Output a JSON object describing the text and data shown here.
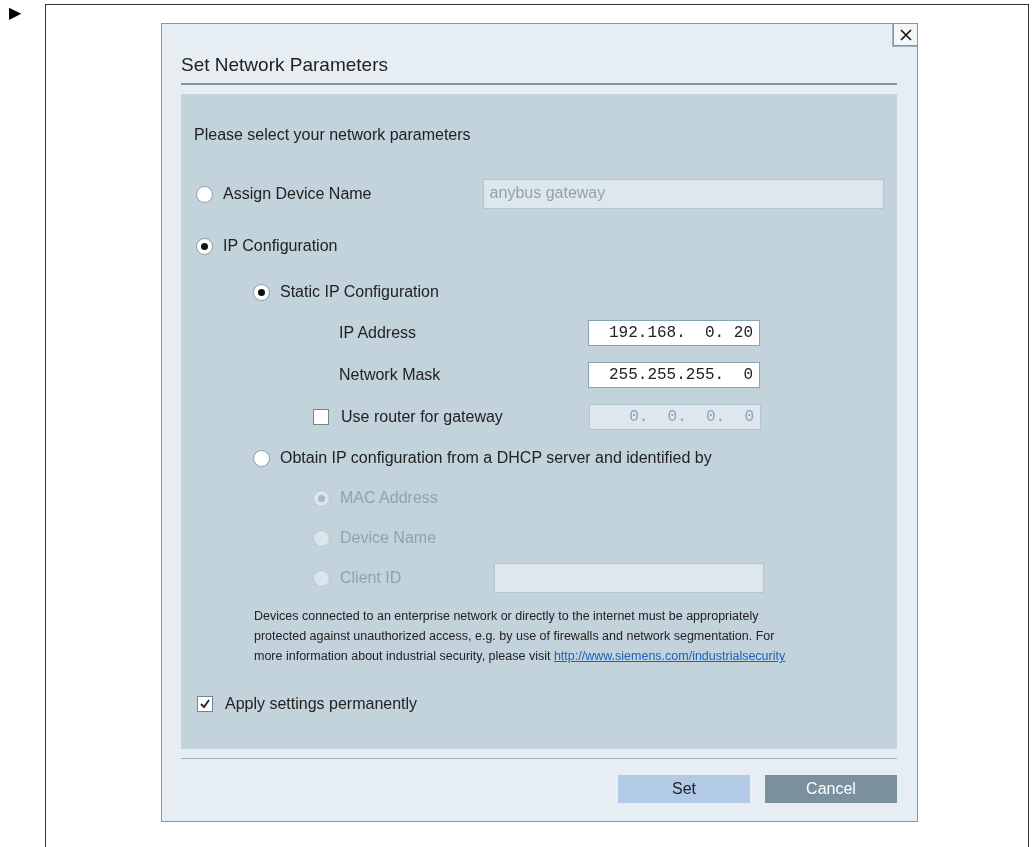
{
  "marker": "▶",
  "dialog": {
    "title": "Set Network Parameters",
    "prompt": "Please select your network parameters",
    "options": [
      {
        "kind": "radio",
        "label": "Assign Device Name",
        "selected": false,
        "disabled": false,
        "field": {
          "kind": "text",
          "value": "anybus gateway",
          "disabled": true
        }
      },
      {
        "kind": "radio",
        "label": "IP Configuration",
        "selected": true,
        "disabled": false,
        "children": [
          {
            "kind": "radio",
            "label": "Static IP Configuration",
            "selected": true,
            "disabled": false,
            "children": [
              {
                "kind": "field",
                "label": "IP Address",
                "field": {
                  "kind": "ip",
                  "value": "192.168.  0. 20",
                  "disabled": false
                }
              },
              {
                "kind": "field",
                "label": "Network Mask",
                "field": {
                  "kind": "ip",
                  "value": "255.255.255.  0",
                  "disabled": false
                }
              },
              {
                "kind": "checkbox",
                "label": "Use router for gateway",
                "checked": false,
                "field": {
                  "kind": "ip",
                  "value": "  0.  0.  0.  0",
                  "disabled": true
                }
              }
            ]
          },
          {
            "kind": "radio",
            "label": "Obtain IP configuration from a DHCP server and identified by",
            "selected": false,
            "disabled": false,
            "children": [
              {
                "kind": "radio",
                "label": "MAC Address",
                "selected": true,
                "disabled": true
              },
              {
                "kind": "radio",
                "label": "Device Name",
                "selected": false,
                "disabled": true
              },
              {
                "kind": "radio",
                "label": "Client ID",
                "selected": false,
                "disabled": true,
                "field": {
                  "kind": "text",
                  "disabled": true
                }
              }
            ]
          }
        ]
      }
    ],
    "notice": {
      "text": "Devices connected to an enterprise network or directly to the internet must be appropriately protected against unauthorized access, e.g. by use of firewalls and network segmentation. For more information about industrial security, please visit",
      "link": "http://www.siemens.com/industrialsecurity"
    },
    "apply": {
      "label": "Apply settings permanently",
      "checked": true
    },
    "buttons": [
      {
        "label": "Set",
        "kind": "primary"
      },
      {
        "label": "Cancel",
        "kind": "secondary"
      }
    ]
  }
}
